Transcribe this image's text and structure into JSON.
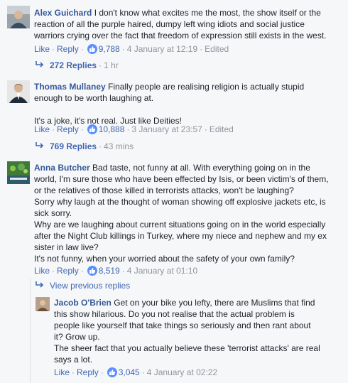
{
  "comments": [
    {
      "author": "Alex Guichard",
      "lines": [
        "I don't know what excites me the most, the show itself or the",
        "reaction of all the purple haired, dumpy left wing idiots and social justice",
        "warriors crying over the fact that freedom of expression still exists in the west."
      ],
      "like_label": "Like",
      "reply_label": "Reply",
      "likes": "9,788",
      "timestamp": "4 January at 12:19",
      "edited": "Edited",
      "replies_count": "272 Replies",
      "replies_age": "1 hr"
    },
    {
      "author": "Thomas Mullaney",
      "lines": [
        "Finally people are realising religion is actually stupid",
        "enough to be worth laughing at."
      ],
      "extra_lines": [
        "It's a joke, it's not real. Just like Deities!"
      ],
      "like_label": "Like",
      "reply_label": "Reply",
      "likes": "10,888",
      "timestamp": "3 January at 23:57",
      "edited": "Edited",
      "replies_count": "769 Replies",
      "replies_age": "43 mins"
    },
    {
      "author": "Anna Butcher",
      "lines": [
        "Bad taste, not funny at all. With everything going on in the",
        "world, I'm sure those who have been effected by Isis, or been victim's of them,",
        "or the relatives of those killed in terrorists attacks, won't be laughing?",
        "Sorry why laugh at the thought of woman showing off explosive jackets etc, is",
        "sick sorry.",
        "Why are we laughing about current situations going on in the world especially",
        "after the Night Club killings in Turkey, where my niece and nephew and my ex",
        "sister in law live?",
        "It's not funny, when your worried about the safety of your own family?"
      ],
      "like_label": "Like",
      "reply_label": "Reply",
      "likes": "8,519",
      "timestamp": "4 January at 01:10",
      "view_previous": "View previous replies"
    },
    {
      "author": "Jacob O'Brien",
      "lines": [
        "Get on your bike you lefty, there are Muslims that find",
        "this show hilarious. Do you not realise that the actual problem is",
        "people like yourself that take things so seriously and then rant about",
        "it? Grow up.",
        "The sheer fact that you actually believe these 'terrorist attacks' are real",
        "says a lot."
      ],
      "like_label": "Like",
      "reply_label": "Reply",
      "likes": "3,045",
      "timestamp": "4 January at 02:22"
    }
  ],
  "separator": "·",
  "colors": {
    "link": "#4267b2",
    "author": "#365899",
    "meta": "#90949c",
    "like_badge": "#5890ff"
  }
}
